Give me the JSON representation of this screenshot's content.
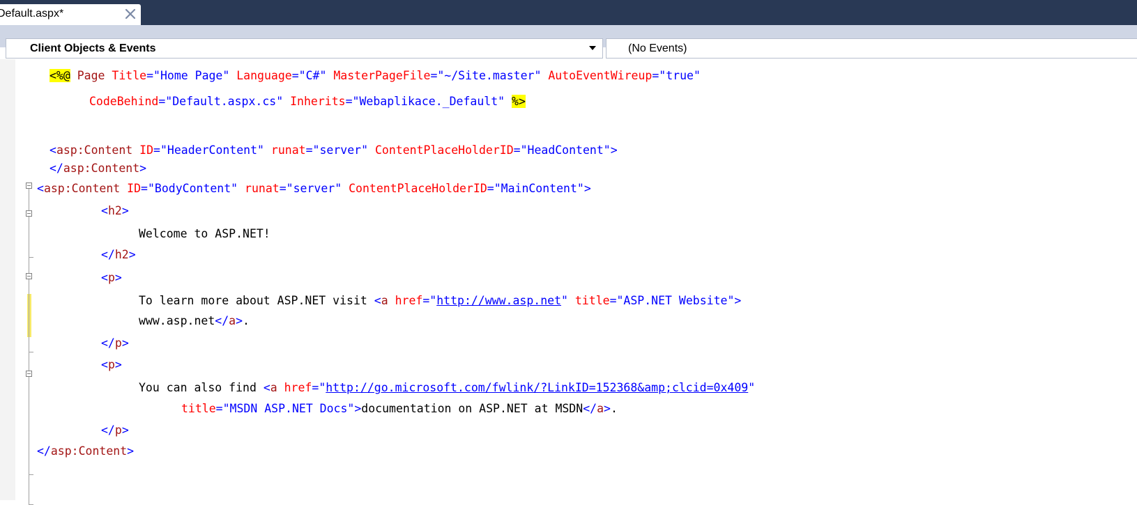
{
  "tab": {
    "label": "Default.aspx*",
    "close_glyph": "✕"
  },
  "navbar": {
    "objects_label": "Client Objects & Events",
    "events_label": "(No Events)"
  },
  "code": {
    "line1": [
      {
        "t": "<%@",
        "c": "hl"
      },
      {
        "t": " Page ",
        "c": "maroon"
      },
      {
        "t": "Title",
        "c": "red"
      },
      {
        "t": "=",
        "c": "blue"
      },
      {
        "t": "\"Home Page\"",
        "c": "blue"
      },
      {
        "t": " ",
        "c": "black"
      },
      {
        "t": "Language",
        "c": "red"
      },
      {
        "t": "=",
        "c": "blue"
      },
      {
        "t": "\"C#\"",
        "c": "blue"
      },
      {
        "t": " ",
        "c": "black"
      },
      {
        "t": "MasterPageFile",
        "c": "red"
      },
      {
        "t": "=",
        "c": "blue"
      },
      {
        "t": "\"~/Site.master\"",
        "c": "blue"
      },
      {
        "t": " ",
        "c": "black"
      },
      {
        "t": "AutoEventWireup",
        "c": "red"
      },
      {
        "t": "=",
        "c": "blue"
      },
      {
        "t": "\"true\"",
        "c": "blue"
      }
    ],
    "line2": [
      {
        "t": "CodeBehind",
        "c": "red"
      },
      {
        "t": "=",
        "c": "blue"
      },
      {
        "t": "\"Default.aspx.cs\"",
        "c": "blue"
      },
      {
        "t": " ",
        "c": "black"
      },
      {
        "t": "Inherits",
        "c": "red"
      },
      {
        "t": "=",
        "c": "blue"
      },
      {
        "t": "\"Webaplikace._Default\"",
        "c": "blue"
      },
      {
        "t": " ",
        "c": "black"
      },
      {
        "t": "%>",
        "c": "hl"
      }
    ],
    "line3": [],
    "line4": [
      {
        "t": "<",
        "c": "blue"
      },
      {
        "t": "asp:Content",
        "c": "maroon"
      },
      {
        "t": " ",
        "c": "black"
      },
      {
        "t": "ID",
        "c": "red"
      },
      {
        "t": "=",
        "c": "blue"
      },
      {
        "t": "\"HeaderContent\"",
        "c": "blue"
      },
      {
        "t": " ",
        "c": "black"
      },
      {
        "t": "runat",
        "c": "red"
      },
      {
        "t": "=",
        "c": "blue"
      },
      {
        "t": "\"server\"",
        "c": "blue"
      },
      {
        "t": " ",
        "c": "black"
      },
      {
        "t": "ContentPlaceHolderID",
        "c": "red"
      },
      {
        "t": "=",
        "c": "blue"
      },
      {
        "t": "\"HeadContent\"",
        "c": "blue"
      },
      {
        "t": ">",
        "c": "blue"
      }
    ],
    "line5": [
      {
        "t": "</",
        "c": "blue"
      },
      {
        "t": "asp:Content",
        "c": "maroon"
      },
      {
        "t": ">",
        "c": "blue"
      }
    ],
    "line6": [
      {
        "t": "<",
        "c": "blue"
      },
      {
        "t": "asp:Content",
        "c": "maroon"
      },
      {
        "t": " ",
        "c": "black"
      },
      {
        "t": "ID",
        "c": "red"
      },
      {
        "t": "=",
        "c": "blue"
      },
      {
        "t": "\"BodyContent\"",
        "c": "blue"
      },
      {
        "t": " ",
        "c": "black"
      },
      {
        "t": "runat",
        "c": "red"
      },
      {
        "t": "=",
        "c": "blue"
      },
      {
        "t": "\"server\"",
        "c": "blue"
      },
      {
        "t": " ",
        "c": "black"
      },
      {
        "t": "ContentPlaceHolderID",
        "c": "red"
      },
      {
        "t": "=",
        "c": "blue"
      },
      {
        "t": "\"MainContent\"",
        "c": "blue"
      },
      {
        "t": ">",
        "c": "blue"
      }
    ],
    "line7": [
      {
        "t": "<",
        "c": "blue"
      },
      {
        "t": "h2",
        "c": "maroon"
      },
      {
        "t": ">",
        "c": "blue"
      }
    ],
    "line8": [
      {
        "t": "Welcome to ASP.NET!",
        "c": "black"
      }
    ],
    "line9": [
      {
        "t": "</",
        "c": "blue"
      },
      {
        "t": "h2",
        "c": "maroon"
      },
      {
        "t": ">",
        "c": "blue"
      }
    ],
    "line10": [
      {
        "t": "<",
        "c": "blue"
      },
      {
        "t": "p",
        "c": "maroon"
      },
      {
        "t": ">",
        "c": "blue"
      }
    ],
    "line11": [
      {
        "t": "To learn more about ASP.NET visit ",
        "c": "black"
      },
      {
        "t": "<",
        "c": "blue"
      },
      {
        "t": "a",
        "c": "maroon"
      },
      {
        "t": " ",
        "c": "black"
      },
      {
        "t": "href",
        "c": "red"
      },
      {
        "t": "=",
        "c": "blue"
      },
      {
        "t": "\"",
        "c": "blue"
      },
      {
        "t": "http://www.asp.net",
        "c": "link"
      },
      {
        "t": "\"",
        "c": "blue"
      },
      {
        "t": " ",
        "c": "black"
      },
      {
        "t": "title",
        "c": "red"
      },
      {
        "t": "=",
        "c": "blue"
      },
      {
        "t": "\"ASP.NET Website\"",
        "c": "blue"
      },
      {
        "t": ">",
        "c": "blue"
      }
    ],
    "line12": [
      {
        "t": "www.asp.net",
        "c": "black"
      },
      {
        "t": "</",
        "c": "blue"
      },
      {
        "t": "a",
        "c": "maroon"
      },
      {
        "t": ">",
        "c": "blue"
      },
      {
        "t": ".",
        "c": "black"
      }
    ],
    "line13": [
      {
        "t": "</",
        "c": "blue"
      },
      {
        "t": "p",
        "c": "maroon"
      },
      {
        "t": ">",
        "c": "blue"
      }
    ],
    "line14": [
      {
        "t": "<",
        "c": "blue"
      },
      {
        "t": "p",
        "c": "maroon"
      },
      {
        "t": ">",
        "c": "blue"
      }
    ],
    "line15": [
      {
        "t": "You can also find ",
        "c": "black"
      },
      {
        "t": "<",
        "c": "blue"
      },
      {
        "t": "a",
        "c": "maroon"
      },
      {
        "t": " ",
        "c": "black"
      },
      {
        "t": "href",
        "c": "red"
      },
      {
        "t": "=",
        "c": "blue"
      },
      {
        "t": "\"",
        "c": "blue"
      },
      {
        "t": "http://go.microsoft.com/fwlink/?LinkID=152368&amp;clcid=0x409",
        "c": "link"
      },
      {
        "t": "\"",
        "c": "blue"
      }
    ],
    "line16": [
      {
        "t": "title",
        "c": "red"
      },
      {
        "t": "=",
        "c": "blue"
      },
      {
        "t": "\"MSDN ASP.NET Docs\"",
        "c": "blue"
      },
      {
        "t": ">",
        "c": "blue"
      },
      {
        "t": "documentation on ASP.NET at MSDN",
        "c": "black"
      },
      {
        "t": "</",
        "c": "blue"
      },
      {
        "t": "a",
        "c": "maroon"
      },
      {
        "t": ">",
        "c": "blue"
      },
      {
        "t": ".",
        "c": "black"
      }
    ],
    "line17": [
      {
        "t": "</",
        "c": "blue"
      },
      {
        "t": "p",
        "c": "maroon"
      },
      {
        "t": ">",
        "c": "blue"
      }
    ],
    "line18": [
      {
        "t": "</",
        "c": "blue"
      },
      {
        "t": "asp:Content",
        "c": "maroon"
      },
      {
        "t": ">",
        "c": "blue"
      }
    ]
  },
  "colors": {
    "tabstrip": "#293955",
    "navbar": "#cfd6e5",
    "keyword_blue": "#0000ff",
    "element_maroon": "#a31515",
    "attribute_red": "#ff0000",
    "directive_highlight": "#ffff00",
    "change_marker": "#f6e96b"
  }
}
